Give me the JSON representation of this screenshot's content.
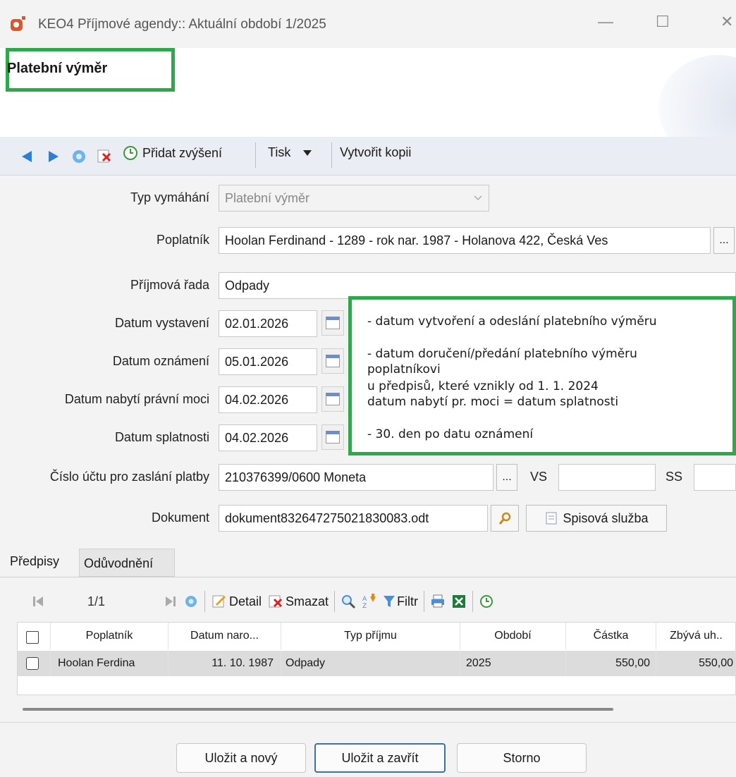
{
  "window": {
    "title": "KEO4 Příjmové agendy:: Aktuální období 1/2025",
    "minimize": "—",
    "maximize": "☐",
    "close": "✕"
  },
  "page": {
    "title": "Platební výměr"
  },
  "toolbar": {
    "add_increase": "Přidat zvýšení",
    "print": "Tisk",
    "copy": "Vytvořit kopii"
  },
  "form": {
    "typ_label": "Typ vymáhání",
    "typ_value": "Platební výměr",
    "poplatnik_label": "Poplatník",
    "poplatnik_value": "Hoolan Ferdinand - 1289 - rok nar. 1987 - Holanova 422, Česká Ves",
    "more": "...",
    "rada_label": "Příjmová řada",
    "rada_value": "Odpady",
    "vystaveni_label": "Datum vystavení",
    "vystaveni_value": "02.01.2026",
    "oznameni_label": "Datum oznámení",
    "oznameni_value": "05.01.2026",
    "pravni_label": "Datum nabytí právní moci",
    "pravni_value": "04.02.2026",
    "splatnost_label": "Datum splatnosti",
    "splatnost_value": "04.02.2026",
    "ucet_label": "Číslo účtu pro zaslání platby",
    "ucet_value": "210376399/0600 Moneta",
    "vs_label": "VS",
    "vs_value": "",
    "ss_label": "SS",
    "ss_value": "",
    "dokument_label": "Dokument",
    "dokument_value": "dokument832647275021830083.odt",
    "spisova": "Spisová služba"
  },
  "note": {
    "line1": "- datum vytvoření a odeslání platebního výměru",
    "line2": "- datum doručení/předání platebního výměru",
    "line3": "poplatníkovi",
    "line4": "u předpisů, které vznikly od 1. 1. 2024",
    "line5": "datum nabytí pr. moci = datum splatnosti",
    "line6": "- 30. den po datu oznámení"
  },
  "tabs": [
    "Předpisy",
    "Odůvodnění"
  ],
  "grid": {
    "page": "1/1",
    "detail": "Detail",
    "delete": "Smazat",
    "filter": "Filtr",
    "columns": [
      "Poplatník",
      "Datum naro...",
      "Typ příjmu",
      "Období",
      "Částka",
      "Zbývá uh.."
    ],
    "rows": [
      {
        "poplatnik": "Hoolan Ferdina",
        "datum": "11. 10. 1987",
        "typ": "Odpady",
        "obdobi": "2025",
        "castka": "550,00",
        "zbyva": "550,00"
      }
    ]
  },
  "footer": {
    "save_new": "Uložit a nový",
    "save_close": "Uložit a zavřít",
    "cancel": "Storno"
  },
  "colors": {
    "highlight": "#2ea84a"
  }
}
